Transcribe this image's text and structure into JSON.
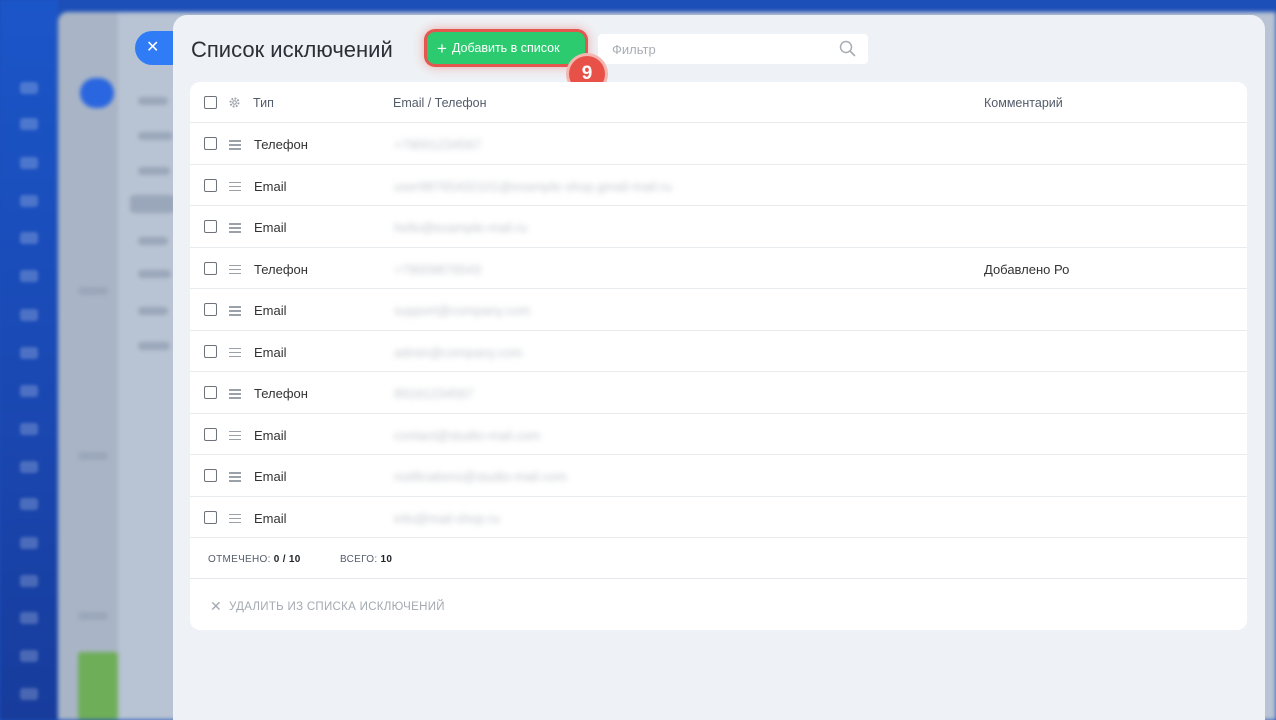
{
  "panel": {
    "title": "Список исключений",
    "add_button_label": "Добавить в список",
    "step_badge": "9",
    "filter_placeholder": "Фильтр"
  },
  "table": {
    "columns": {
      "type": "Тип",
      "contact": "Email / Телефон",
      "comment": "Комментарий"
    },
    "rows": [
      {
        "type": "Телефон",
        "contact": "+79001234567",
        "comment": ""
      },
      {
        "type": "Email",
        "contact": "user98765432101@example-shop.gmail-mail.ru",
        "comment": ""
      },
      {
        "type": "Email",
        "contact": "hello@example-mail.ru",
        "comment": ""
      },
      {
        "type": "Телефон",
        "contact": "+79009876543",
        "comment": "Добавлено Ро"
      },
      {
        "type": "Email",
        "contact": "support@company.com",
        "comment": ""
      },
      {
        "type": "Email",
        "contact": "admin@company.com",
        "comment": ""
      },
      {
        "type": "Телефон",
        "contact": "89161234567",
        "comment": ""
      },
      {
        "type": "Email",
        "contact": "contact@studio-mail.com",
        "comment": ""
      },
      {
        "type": "Email",
        "contact": "notifications@studio-mail.com",
        "comment": ""
      },
      {
        "type": "Email",
        "contact": "info@mail-shop.ru",
        "comment": ""
      }
    ]
  },
  "summary": {
    "selected_label": "ОТМЕЧЕНО:",
    "selected_value": "0 / 10",
    "total_label": "ВСЕГО:",
    "total_value": "10"
  },
  "actions": {
    "delete_label": "УДАЛИТЬ ИЗ СПИСКА ИСКЛЮЧЕНИЙ"
  },
  "colors": {
    "accent_green": "#2ccb6f",
    "highlight_red": "#e85148",
    "close_blue": "#2f7cf6"
  },
  "icons": {
    "close": "close-icon",
    "plus": "plus-icon",
    "search": "search-icon",
    "gear": "gear-icon",
    "drag": "drag-handle-icon",
    "delete": "x-icon"
  }
}
